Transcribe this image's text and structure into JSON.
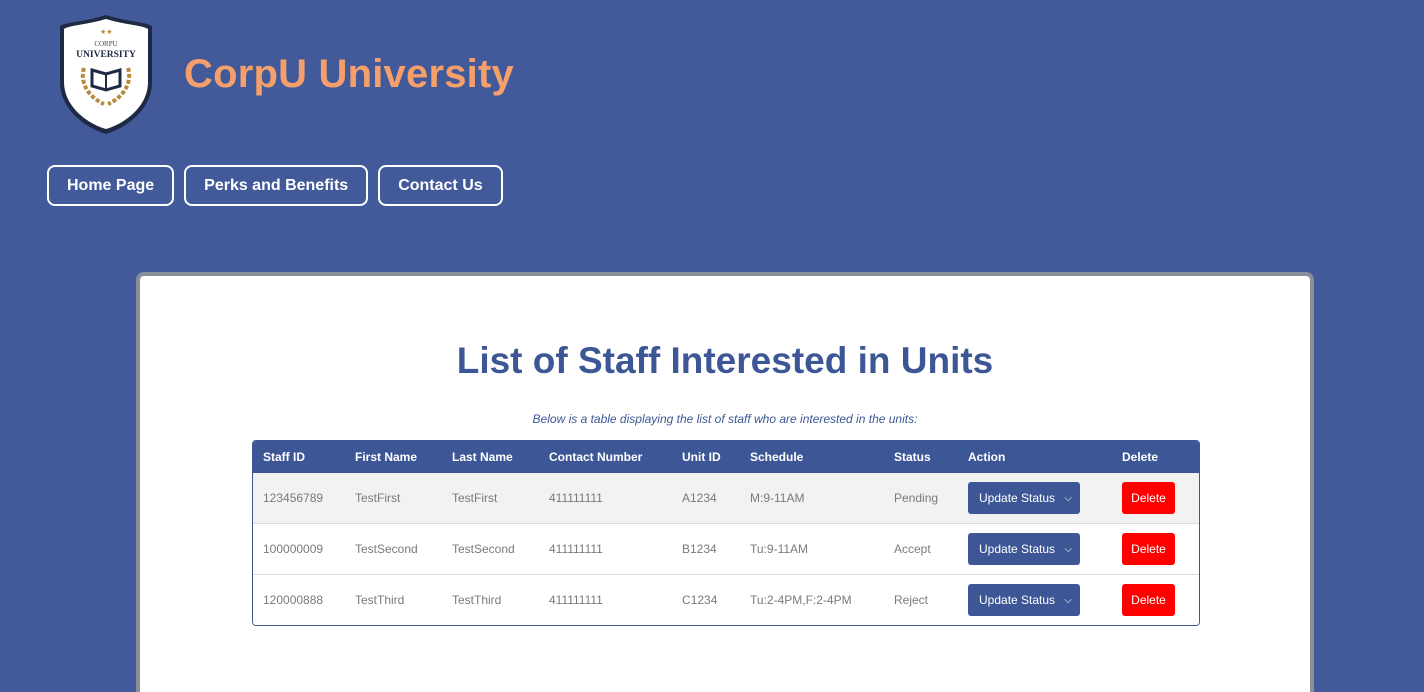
{
  "brand": {
    "logo_top": "CORPU",
    "logo_main": "UNIVERSITY",
    "name": "CorpU University"
  },
  "nav": [
    "Home Page",
    "Perks and Benefits",
    "Contact Us"
  ],
  "page": {
    "title": "List of Staff Interested in Units",
    "subtitle": "Below is a table displaying the list of staff who are interested in the units:"
  },
  "table": {
    "headers": [
      "Staff ID",
      "First Name",
      "Last Name",
      "Contact Number",
      "Unit ID",
      "Schedule",
      "Status",
      "Action",
      "Delete"
    ],
    "rows": [
      {
        "staff_id": "123456789",
        "first": "TestFirst",
        "last": "TestFirst",
        "contact": "411111111",
        "unit": "A1234",
        "schedule": "M:9-11AM",
        "status": "Pending",
        "action": "Update Status",
        "delete": "Delete"
      },
      {
        "staff_id": "100000009",
        "first": "TestSecond",
        "last": "TestSecond",
        "contact": "411111111",
        "unit": "B1234",
        "schedule": "Tu:9-11AM",
        "status": "Accept",
        "action": "Update Status",
        "delete": "Delete"
      },
      {
        "staff_id": "120000888",
        "first": "TestThird",
        "last": "TestThird",
        "contact": "411111111",
        "unit": "C1234",
        "schedule": "Tu:2-4PM,F:2-4PM",
        "status": "Reject",
        "action": "Update Status",
        "delete": "Delete"
      }
    ]
  },
  "colors": {
    "background": "#425a99",
    "brand_accent": "#f5a06a",
    "primary": "#3d5796",
    "danger": "#ff0000"
  },
  "icons": {
    "logo": "university-crest-icon",
    "dropdown": "chevron-down-icon"
  }
}
